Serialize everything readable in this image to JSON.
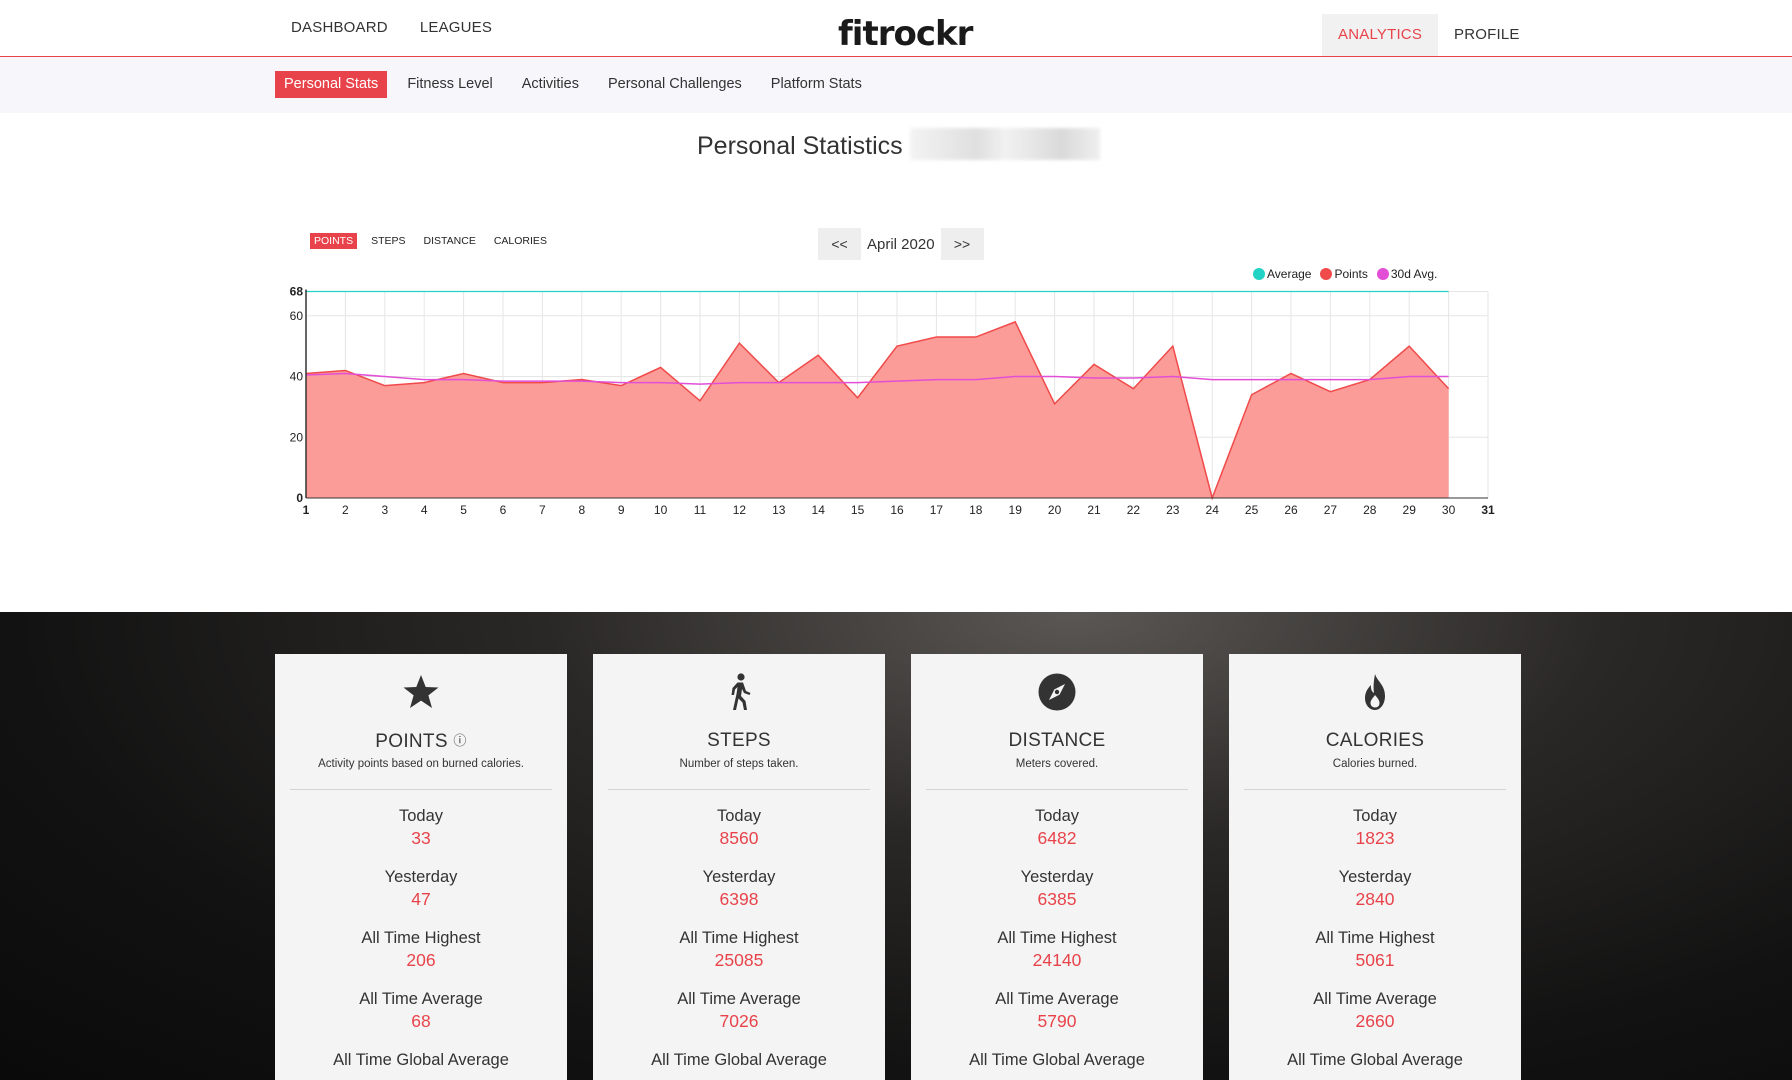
{
  "topnav": {
    "left": [
      "DASHBOARD",
      "LEAGUES"
    ],
    "logo": "fitrockr",
    "right": [
      "ANALYTICS",
      "PROFILE"
    ]
  },
  "subnav": {
    "items": [
      "Personal Stats",
      "Fitness Level",
      "Activities",
      "Personal Challenges",
      "Platform Stats"
    ]
  },
  "page": {
    "title": "Personal Statistics"
  },
  "chart_controls": {
    "tabs": [
      "POINTS",
      "STEPS",
      "DISTANCE",
      "CALORIES"
    ],
    "prev": "<<",
    "month": "April 2020",
    "next": ">>"
  },
  "chart_data": {
    "type": "area",
    "x": [
      1,
      2,
      3,
      4,
      5,
      6,
      7,
      8,
      9,
      10,
      11,
      12,
      13,
      14,
      15,
      16,
      17,
      18,
      19,
      20,
      21,
      22,
      23,
      24,
      25,
      26,
      27,
      28,
      29,
      30
    ],
    "x_ticks": [
      "1",
      "2",
      "3",
      "4",
      "5",
      "6",
      "7",
      "8",
      "9",
      "10",
      "11",
      "12",
      "13",
      "14",
      "15",
      "16",
      "17",
      "18",
      "19",
      "20",
      "21",
      "22",
      "23",
      "24",
      "25",
      "26",
      "27",
      "28",
      "29",
      "30",
      "31"
    ],
    "y_ticks": [
      "0",
      "20",
      "40",
      "60",
      "68"
    ],
    "ylim": [
      0,
      68
    ],
    "legend": "top-right",
    "grid": true,
    "series": [
      {
        "name": "Average",
        "color": "#22d3c5",
        "values": [
          68,
          68,
          68,
          68,
          68,
          68,
          68,
          68,
          68,
          68,
          68,
          68,
          68,
          68,
          68,
          68,
          68,
          68,
          68,
          68,
          68,
          68,
          68,
          68,
          68,
          68,
          68,
          68,
          68,
          68
        ]
      },
      {
        "name": "Points",
        "color": "#f04a4a",
        "fill": "#fb9c98",
        "values": [
          41,
          42,
          37,
          38,
          41,
          38,
          38,
          39,
          37,
          43,
          32,
          51,
          38,
          47,
          33,
          50,
          53,
          53,
          58,
          31,
          44,
          36,
          50,
          0,
          34,
          41,
          35,
          39,
          50,
          36
        ]
      },
      {
        "name": "30d Avg.",
        "color": "#e24fd6",
        "values": [
          40.5,
          41,
          40,
          39,
          39,
          38.5,
          38.5,
          38.5,
          38,
          38,
          37.5,
          38,
          38,
          38,
          38,
          38.5,
          39,
          39,
          40,
          40,
          39.5,
          39.5,
          40,
          39,
          39,
          39,
          39,
          39,
          40,
          40
        ]
      }
    ]
  },
  "cards": [
    {
      "title": "POINTS",
      "info": "ⓘ",
      "desc": "Activity points based on burned calories.",
      "stats": [
        {
          "label": "Today",
          "value": "33"
        },
        {
          "label": "Yesterday",
          "value": "47"
        },
        {
          "label": "All Time Highest",
          "value": "206"
        },
        {
          "label": "All Time Average",
          "value": "68"
        },
        {
          "label": "All Time Global Average",
          "value": ""
        }
      ]
    },
    {
      "title": "STEPS",
      "info": "",
      "desc": "Number of steps taken.",
      "stats": [
        {
          "label": "Today",
          "value": "8560"
        },
        {
          "label": "Yesterday",
          "value": "6398"
        },
        {
          "label": "All Time Highest",
          "value": "25085"
        },
        {
          "label": "All Time Average",
          "value": "7026"
        },
        {
          "label": "All Time Global Average",
          "value": ""
        }
      ]
    },
    {
      "title": "DISTANCE",
      "info": "",
      "desc": "Meters covered.",
      "stats": [
        {
          "label": "Today",
          "value": "6482"
        },
        {
          "label": "Yesterday",
          "value": "6385"
        },
        {
          "label": "All Time Highest",
          "value": "24140"
        },
        {
          "label": "All Time Average",
          "value": "5790"
        },
        {
          "label": "All Time Global Average",
          "value": ""
        }
      ]
    },
    {
      "title": "CALORIES",
      "info": "",
      "desc": "Calories burned.",
      "stats": [
        {
          "label": "Today",
          "value": "1823"
        },
        {
          "label": "Yesterday",
          "value": "2840"
        },
        {
          "label": "All Time Highest",
          "value": "5061"
        },
        {
          "label": "All Time Average",
          "value": "2660"
        },
        {
          "label": "All Time Global Average",
          "value": ""
        }
      ]
    }
  ],
  "icons": [
    "star-icon",
    "walking-icon",
    "compass-icon",
    "flame-icon"
  ],
  "colors": {
    "accent": "#e8434a"
  }
}
